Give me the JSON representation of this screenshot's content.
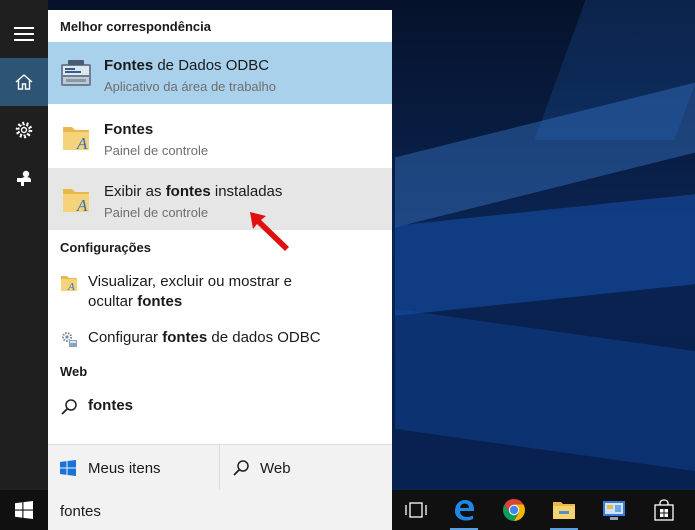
{
  "left_rail": {
    "items": [
      {
        "name": "menu",
        "icon": "hamburger-icon"
      },
      {
        "name": "home",
        "icon": "home-icon",
        "active": true
      },
      {
        "name": "settings",
        "icon": "gear-icon"
      },
      {
        "name": "feedback",
        "icon": "feedback-icon"
      }
    ]
  },
  "best_match": {
    "header": "Melhor correspondência",
    "results": [
      {
        "title_bold": "Fontes",
        "title_rest": " de Dados ODBC",
        "subtitle": "Aplicativo da área de trabalho",
        "icon": "odbc-icon"
      },
      {
        "title_bold": "Fontes",
        "title_rest": "",
        "subtitle": "Painel de controle",
        "icon": "fonts-folder-icon"
      },
      {
        "title_pre": "Exibir as ",
        "title_bold": "fontes",
        "title_rest": " instaladas",
        "subtitle": "Painel de controle",
        "icon": "fonts-folder-icon"
      }
    ]
  },
  "settings_section": {
    "header": "Configurações",
    "items": [
      {
        "line1": "Visualizar, excluir ou mostrar e",
        "line2_pre": "ocultar ",
        "line2_bold": "fontes",
        "icon": "fonts-small-icon"
      },
      {
        "pre": "Configurar ",
        "bold": "fontes",
        "rest": " de dados ODBC",
        "icon": "odbc-small-icon"
      }
    ]
  },
  "web_section": {
    "header": "Web",
    "query": "fontes",
    "icon": "search-icon"
  },
  "bottom": {
    "my_items": "Meus itens",
    "web": "Web"
  },
  "taskbar": {
    "search_value": "fontes",
    "icons": [
      "task-view-icon",
      "edge-icon",
      "chrome-icon",
      "file-explorer-icon",
      "control-panel-icon",
      "store-icon"
    ]
  },
  "colors": {
    "selected": "#a9d1ec",
    "hover": "#e6e6e6",
    "rail": "#1f1f1f",
    "rail_active": "#2d5573",
    "arrow": "#e01010"
  }
}
